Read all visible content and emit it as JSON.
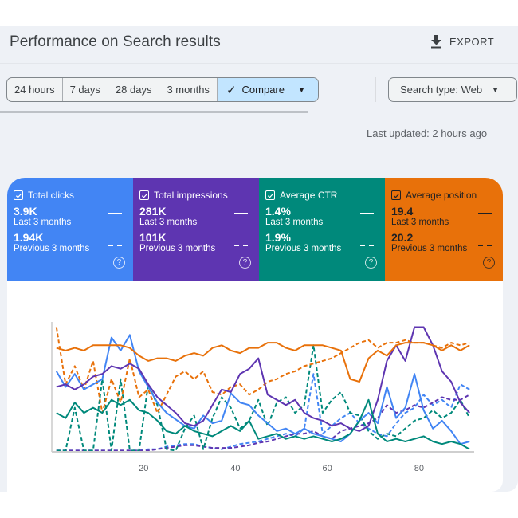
{
  "header": {
    "title": "Performance on Search results",
    "export_label": "EXPORT",
    "export_icon": "download-icon"
  },
  "filters": {
    "date_ranges": [
      "24 hours",
      "7 days",
      "28 days",
      "3 months"
    ],
    "compare": {
      "label": "Compare",
      "selected": true,
      "icon": "check-icon"
    },
    "search_type": "Search type: Web"
  },
  "last_updated": "Last updated: 2 hours ago",
  "metrics": [
    {
      "name": "Total clicks",
      "checked": true,
      "current": "3.9K",
      "current_label": "Last 3 months",
      "previous": "1.94K",
      "previous_label": "Previous 3 months",
      "color": "#4285f4"
    },
    {
      "name": "Total impressions",
      "checked": true,
      "current": "281K",
      "current_label": "Last 3 months",
      "previous": "101K",
      "previous_label": "Previous 3 months",
      "color": "#5e35b1"
    },
    {
      "name": "Average CTR",
      "checked": true,
      "current": "1.4%",
      "current_label": "Last 3 months",
      "previous": "1.9%",
      "previous_label": "Previous 3 months",
      "color": "#00897b"
    },
    {
      "name": "Average position",
      "checked": true,
      "current": "19.4",
      "current_label": "Last 3 months",
      "previous": "20.2",
      "previous_label": "Previous 3 months",
      "color": "#e8710a"
    }
  ],
  "help_glyph": "?",
  "chart_data": {
    "type": "line",
    "title": "",
    "xlabel": "",
    "ylabel": "",
    "x_ticks": [
      20,
      40,
      60,
      80
    ],
    "xlim": [
      0,
      92
    ],
    "ylim": [
      0,
      100
    ],
    "y_note": "No y-axis labels shown; values are normalized estimates (0 = axis baseline, 100 = top of plot)",
    "grid": false,
    "legend": "metric cards above chart (solid = last 3 months, dashed = previous 3 months)",
    "x": [
      1,
      3,
      5,
      7,
      9,
      11,
      13,
      15,
      17,
      19,
      21,
      23,
      25,
      27,
      29,
      31,
      33,
      35,
      37,
      39,
      41,
      43,
      45,
      47,
      49,
      51,
      53,
      55,
      57,
      59,
      61,
      63,
      65,
      67,
      69,
      71,
      73,
      75,
      77,
      79,
      81,
      83,
      85,
      87,
      89,
      91
    ],
    "series": [
      {
        "name": "Total clicks (Last 3 months)",
        "style": "solid",
        "color": "#4285f4",
        "values": [
          62,
          50,
          60,
          48,
          52,
          56,
          88,
          78,
          90,
          62,
          50,
          38,
          30,
          25,
          20,
          18,
          28,
          22,
          24,
          45,
          38,
          36,
          28,
          22,
          16,
          18,
          14,
          18,
          14,
          12,
          10,
          8,
          14,
          24,
          30,
          22,
          50,
          26,
          34,
          60,
          32,
          18,
          24,
          16,
          6,
          8
        ]
      },
      {
        "name": "Total clicks (Previous 3 months)",
        "style": "dashed",
        "color": "#4285f4",
        "values": [
          1,
          1,
          1,
          1,
          1,
          1,
          1,
          1,
          1,
          1,
          2,
          2,
          4,
          5,
          6,
          6,
          4,
          3,
          2,
          4,
          6,
          7,
          8,
          10,
          12,
          14,
          12,
          18,
          60,
          14,
          20,
          26,
          30,
          22,
          18,
          14,
          12,
          22,
          30,
          34,
          44,
          36,
          40,
          34,
          52,
          48
        ]
      },
      {
        "name": "Total impressions (Last 3 months)",
        "style": "solid",
        "color": "#5e35b1",
        "values": [
          50,
          52,
          48,
          52,
          58,
          60,
          66,
          64,
          68,
          64,
          52,
          42,
          36,
          30,
          22,
          20,
          24,
          36,
          48,
          46,
          60,
          64,
          72,
          44,
          40,
          36,
          40,
          30,
          26,
          24,
          20,
          22,
          18,
          16,
          20,
          40,
          70,
          82,
          70,
          96,
          96,
          82,
          62,
          54,
          38,
          30
        ]
      },
      {
        "name": "Total impressions (Previous 3 months)",
        "style": "dashed",
        "color": "#5e35b1",
        "values": [
          1,
          1,
          1,
          1,
          1,
          1,
          1,
          1,
          1,
          1,
          1,
          2,
          3,
          4,
          5,
          5,
          4,
          3,
          3,
          3,
          4,
          5,
          7,
          8,
          10,
          12,
          14,
          14,
          16,
          12,
          10,
          16,
          18,
          20,
          22,
          26,
          36,
          30,
          32,
          36,
          34,
          38,
          42,
          40,
          40,
          44
        ]
      },
      {
        "name": "Average CTR (Last 3 months)",
        "style": "solid",
        "color": "#00897b",
        "values": [
          30,
          26,
          38,
          30,
          34,
          30,
          40,
          36,
          40,
          32,
          30,
          24,
          16,
          14,
          20,
          16,
          14,
          12,
          16,
          20,
          16,
          24,
          10,
          12,
          14,
          10,
          12,
          10,
          12,
          10,
          8,
          10,
          14,
          24,
          40,
          14,
          8,
          10,
          8,
          10,
          12,
          8,
          6,
          8,
          6,
          2
        ]
      },
      {
        "name": "Average CTR (Previous 3 months)",
        "style": "dashed",
        "color": "#00897b",
        "values": [
          1,
          1,
          34,
          1,
          1,
          56,
          1,
          56,
          1,
          1,
          52,
          36,
          2,
          1,
          18,
          28,
          2,
          26,
          42,
          34,
          18,
          24,
          40,
          20,
          38,
          42,
          30,
          36,
          82,
          30,
          40,
          46,
          30,
          28,
          16,
          10,
          14,
          12,
          18,
          24,
          26,
          32,
          26,
          30,
          40,
          26
        ]
      },
      {
        "name": "Average position (Last 3 months)",
        "style": "solid",
        "color": "#e8710a",
        "values": [
          80,
          78,
          80,
          78,
          82,
          82,
          82,
          82,
          80,
          74,
          70,
          72,
          72,
          70,
          74,
          76,
          74,
          80,
          82,
          78,
          76,
          80,
          80,
          84,
          84,
          80,
          78,
          82,
          82,
          82,
          80,
          78,
          56,
          54,
          72,
          78,
          74,
          82,
          84,
          84,
          84,
          82,
          78,
          82,
          78,
          82
        ]
      },
      {
        "name": "Average position (Previous 3 months)",
        "style": "dashed",
        "color": "#e8710a",
        "values": [
          96,
          52,
          66,
          48,
          70,
          30,
          56,
          38,
          72,
          42,
          48,
          30,
          44,
          58,
          62,
          56,
          62,
          46,
          44,
          50,
          52,
          44,
          48,
          54,
          56,
          60,
          62,
          66,
          68,
          70,
          72,
          76,
          80,
          84,
          86,
          80,
          84,
          84,
          86,
          84,
          84,
          82,
          80,
          84,
          82,
          84
        ]
      }
    ]
  }
}
